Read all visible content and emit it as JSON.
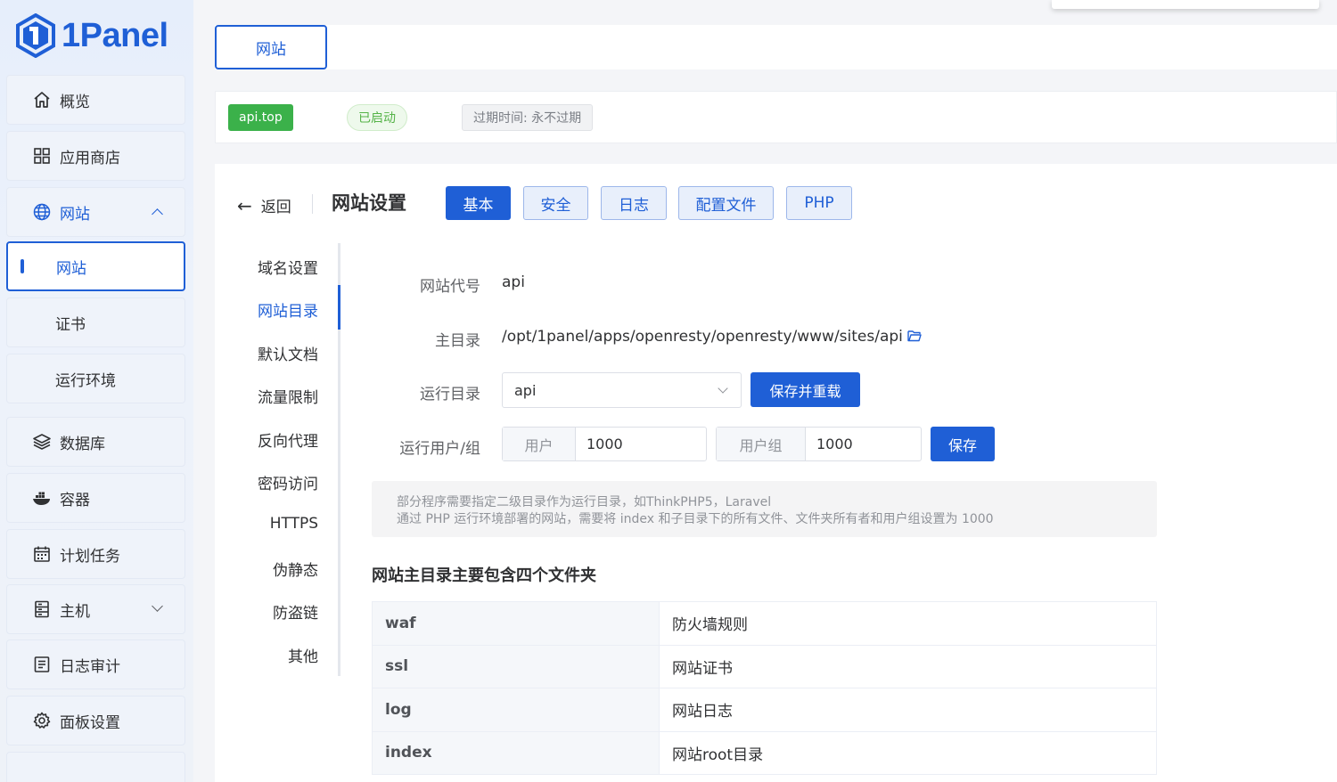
{
  "app": {
    "name": "1Panel"
  },
  "sidebar": {
    "items": [
      {
        "label": "概览",
        "icon": "home-icon"
      },
      {
        "label": "应用商店",
        "icon": "grid-icon"
      },
      {
        "label": "网站",
        "icon": "globe-icon"
      },
      {
        "label": "网站",
        "icon": ""
      },
      {
        "label": "证书",
        "icon": ""
      },
      {
        "label": "运行环境",
        "icon": ""
      },
      {
        "label": "数据库",
        "icon": "layers-icon"
      },
      {
        "label": "容器",
        "icon": "docker-icon"
      },
      {
        "label": "计划任务",
        "icon": "calendar-icon"
      },
      {
        "label": "主机",
        "icon": "host-icon"
      },
      {
        "label": "日志审计",
        "icon": "log-icon"
      },
      {
        "label": "面板设置",
        "icon": "gear-icon"
      }
    ]
  },
  "topbar": {
    "tab": "网站"
  },
  "status": {
    "domain": "api.top",
    "state": "已启动",
    "expire": "过期时间: 永不过期"
  },
  "header": {
    "back": "返回",
    "title": "网站设置",
    "tabs": [
      "基本",
      "安全",
      "日志",
      "配置文件",
      "PHP"
    ]
  },
  "subnav": [
    "域名设置",
    "网站目录",
    "默认文档",
    "流量限制",
    "反向代理",
    "密码访问",
    "HTTPS",
    "伪静态",
    "防盗链",
    "其他"
  ],
  "form": {
    "code_label": "网站代号",
    "code_value": "api",
    "root_label": "主目录",
    "root_value": "/opt/1panel/apps/openresty/openresty/www/sites/api",
    "run_dir_label": "运行目录",
    "run_dir_value": "api",
    "save_reload": "保存并重载",
    "user_group_label": "运行用户/组",
    "user_prefix": "用户",
    "user_value": "1000",
    "group_prefix": "用户组",
    "group_value": "1000",
    "save": "保存"
  },
  "notice": {
    "line1": "部分程序需要指定二级目录作为运行目录，如ThinkPHP5，Laravel",
    "line2": "通过 PHP 运行环境部署的网站，需要将 index 和子目录下的所有文件、文件夹所有者和用户组设置为 1000"
  },
  "folders": {
    "title": "网站主目录主要包含四个文件夹",
    "rows": [
      {
        "name": "waf",
        "desc": "防火墙规则"
      },
      {
        "name": "ssl",
        "desc": "网站证书"
      },
      {
        "name": "log",
        "desc": "网站日志"
      },
      {
        "name": "index",
        "desc": "网站root目录"
      }
    ]
  },
  "colors": {
    "primary": "#1f5fd6",
    "success": "#3bb14a"
  }
}
